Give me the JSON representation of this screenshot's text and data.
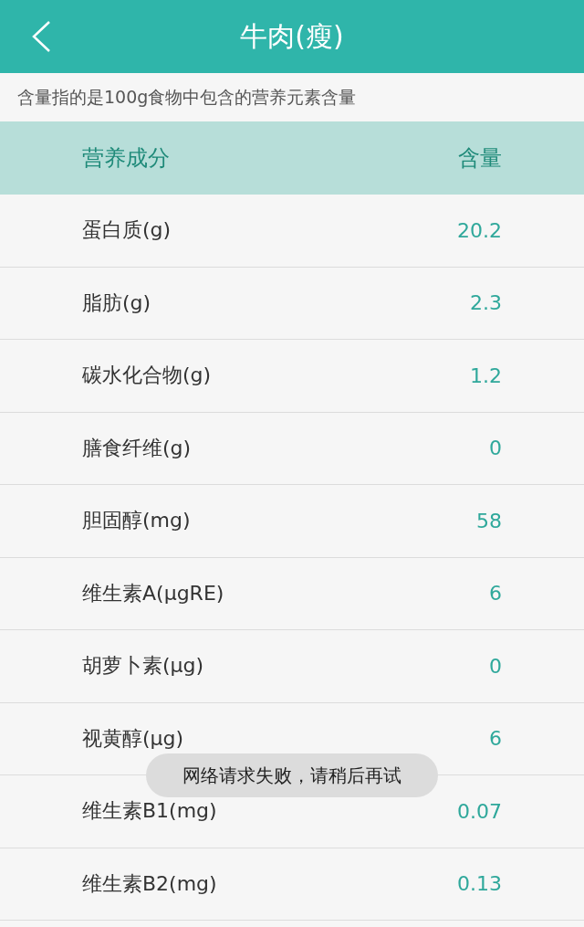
{
  "header": {
    "title": "牛肉(瘦)"
  },
  "note": "含量指的是100g食物中包含的营养元素含量",
  "table": {
    "columns": [
      "营养成分",
      "含量"
    ],
    "rows": [
      {
        "name": "蛋白质(g)",
        "value": "20.2"
      },
      {
        "name": "脂肪(g)",
        "value": "2.3"
      },
      {
        "name": "碳水化合物(g)",
        "value": "1.2"
      },
      {
        "name": "膳食纤维(g)",
        "value": "0"
      },
      {
        "name": "胆固醇(mg)",
        "value": "58"
      },
      {
        "name": "维生素A(μgRE)",
        "value": "6"
      },
      {
        "name": "胡萝卜素(μg)",
        "value": "0"
      },
      {
        "name": "视黄醇(μg)",
        "value": "6"
      },
      {
        "name": "维生素B1(mg)",
        "value": "0.07"
      },
      {
        "name": "维生素B2(mg)",
        "value": "0.13"
      }
    ]
  },
  "toast": "网络请求失败，请稍后再试"
}
